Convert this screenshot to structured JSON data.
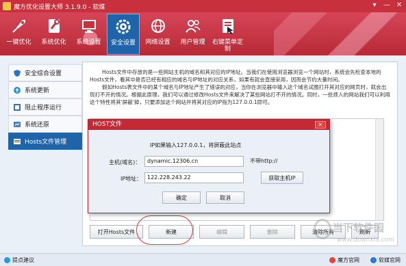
{
  "window": {
    "title": "魔方优化设置大师 3.1.9.0 - 软媒",
    "controls": [
      "▾",
      "—",
      "✕"
    ]
  },
  "nav": {
    "items": [
      {
        "label": "一键优化",
        "icon": "rocket-icon"
      },
      {
        "label": "系统优化",
        "icon": "wrench-icon"
      },
      {
        "label": "系统设置",
        "icon": "monitor-icon"
      },
      {
        "label": "安全设置",
        "icon": "shield-gear-icon",
        "active": true
      },
      {
        "label": "网络设置",
        "icon": "network-icon"
      },
      {
        "label": "用户管理",
        "icon": "users-icon"
      },
      {
        "label": "右键菜单定制",
        "icon": "context-menu-icon"
      }
    ]
  },
  "sidebar": {
    "items": [
      {
        "label": "安全综合设置",
        "icon": "shield-icon"
      },
      {
        "label": "系统更新",
        "icon": "update-icon"
      },
      {
        "label": "阻止程序运行",
        "icon": "block-icon"
      },
      {
        "label": "系统还原",
        "icon": "restore-icon"
      },
      {
        "label": "Hosts文件管理",
        "icon": "hosts-icon",
        "active": true
      }
    ]
  },
  "main": {
    "paragraph1": "Hosts文件中存放的是一些网站主机的域名和其对应的IP地址。当我们在使用浏览器浏览一个网站时，系统会先检查本地的Hosts文件，看其中是否已经有相应的域名与IP地址的对应关系，如果有就会直接采用，因而会节约大量时间。",
    "paragraph2": "假如Hosts表文件中的某个域名与IP地址产生了错误的对应，当你在浏览器中输入这个域名试图打开其对应的网页时，就会出现打不开的情况。根据此原理，我们可以通过修改Hosts文件来解决了某些网站打不开的情况。同时，一些烦人的网站我们可以利用这个特性将其'屏蔽'掉，只要添加这个网站并将其对应的IP指为127.0.0.1即可。"
  },
  "bottom_buttons": {
    "open_hosts": "打开Hosts文件",
    "new": "新建",
    "edit": "编辑",
    "delete": "删除",
    "clear_all": "清除所有",
    "refresh": "刷新"
  },
  "dialog": {
    "title": "HOST文件",
    "close": "✕",
    "note": "IP如果输入127.0.0.1，将屏蔽此站点",
    "host_label": "主机(域名)：",
    "host_value": "dynamic.12306.cn",
    "host_hint": "不带http://",
    "ip_label": "IP地址：",
    "ip_value": "122.228.243.22",
    "get_ip_button": "获取主机IP",
    "ok_button": "确定",
    "cancel_button": "取消"
  },
  "status": {
    "left": "提点建议",
    "right1": "魔方官网",
    "right2": "软媒官网"
  },
  "watermark": {
    "text": "当下软件园",
    "url": "www.downxia.com"
  },
  "colors": {
    "brand_red": "#c9303e",
    "active_blue": "#1f64a8",
    "highlight_circle": "#d33b3b"
  }
}
